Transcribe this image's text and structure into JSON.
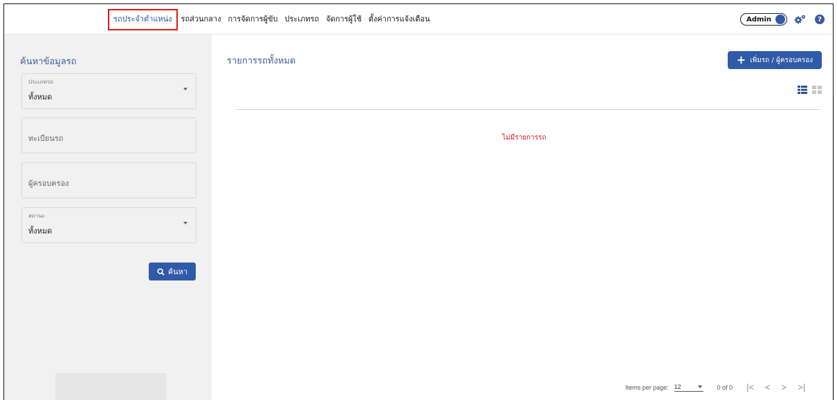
{
  "nav": {
    "items": [
      {
        "label": "รถประจำตำแหน่ง",
        "active": true
      },
      {
        "label": "รถส่วนกลาง",
        "active": false
      },
      {
        "label": "การจัดการผู้ขับ",
        "active": false
      },
      {
        "label": "ประเภทรถ",
        "active": false
      },
      {
        "label": "จัดการผู้ใช้",
        "active": false
      },
      {
        "label": "ตั้งค่าการแจ้งเตือน",
        "active": false
      }
    ],
    "admin_label": "Admin",
    "help_glyph": "?"
  },
  "sidebar": {
    "title": "ค้นหาข้อมูลรถ",
    "type_field": {
      "label": "ประเภทรถ",
      "value": "ทั้งหมด"
    },
    "plate_field": {
      "placeholder": "ทะเบียนรถ"
    },
    "owner_field": {
      "placeholder": "ผู้ครอบครอง"
    },
    "status_field": {
      "label": "สถานะ",
      "value": "ทั้งหมด"
    },
    "search_button": "ค้นหา"
  },
  "main": {
    "title": "รายการรถทั้งหมด",
    "add_button": "เพิ่มรถ / ผู้ครอบครอง",
    "empty_message": "ไม่มีรายการรถ"
  },
  "pagination": {
    "items_per_page_label": "Items per page:",
    "items_per_page_value": "12",
    "range": "0 of 0"
  },
  "colors": {
    "accent": "#2f5aa8",
    "title": "#3c5c9e",
    "highlight": "#e01717",
    "error": "#d11a1a"
  },
  "icons": [
    "gears-icon",
    "help-icon",
    "search-icon",
    "plus-icon",
    "list-view-icon",
    "grid-view-icon",
    "first-page-icon",
    "prev-page-icon",
    "next-page-icon",
    "last-page-icon"
  ]
}
